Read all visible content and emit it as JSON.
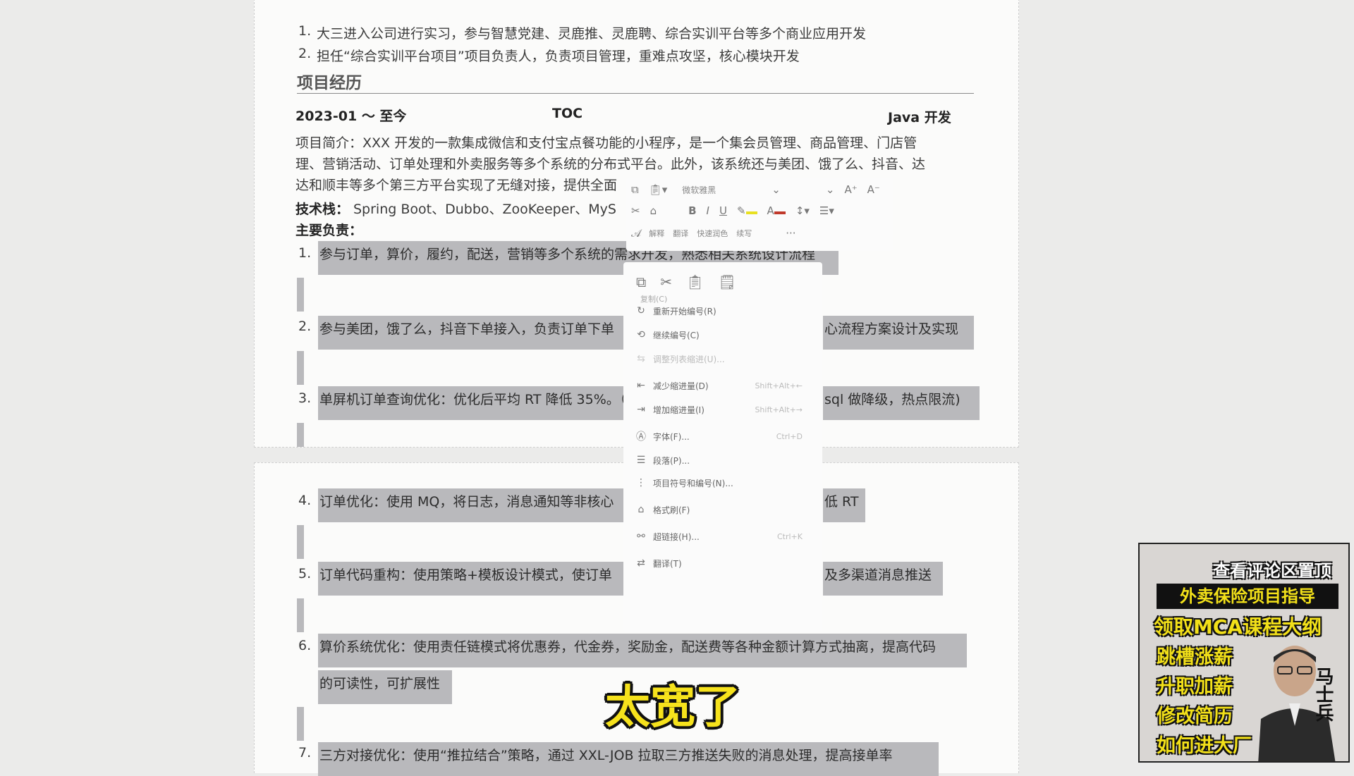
{
  "document": {
    "internship_lines": [
      "大三进入公司进行实习，参与智慧党建、灵鹿推、灵鹿聘、综合实训平台等多个商业应用开发",
      "担任“综合实训平台项目”项目负责人，负责项目管理，重难点攻坚，核心模块开发"
    ],
    "section_title": "项目经历",
    "project": {
      "period": "2023-01 ～ 至今",
      "name": "TOC",
      "role": "Java 开发",
      "intro_lines": [
        "项目简介：XXX 开发的一款集成微信和支付宝点餐功能的小程序，是一个集会员管理、商品管理、门店管",
        "理、营销活动、订单处理和外卖服务等多个系统的分布式平台。此外，该系统还与美团、饿了么、抖音、达",
        "达和顺丰等多个第三方平台实现了无缝对接，提供全面"
      ],
      "tech_label": "技术栈：",
      "tech_value": "Spring Boot、Dubbo、ZooKeeper、MyS",
      "duty_label": "主要负责："
    },
    "duties": [
      {
        "num": "1.",
        "left": "参与订单，算价，履约，配送，营销等多个系统的需求开发，熟悉相关系统设计流程",
        "right": ""
      },
      {
        "num": "2.",
        "left": "参与美团，饿了么，抖音下单接入，负责订单下单",
        "right": "心流程方案设计及实现"
      },
      {
        "num": "3.",
        "left": "单屏机订单查询优化：优化后平均 RT 降低 35%。（",
        "right": "sql 做降级，热点限流)"
      },
      {
        "num": "4.",
        "left": "订单优化：使用 MQ，将日志，消息通知等非核心",
        "right": "低 RT"
      },
      {
        "num": "5.",
        "left": "订单代码重构：使用策略+模板设计模式，使订单",
        "right": "及多渠道消息推送"
      },
      {
        "num": "6.",
        "left": "算价系统优化：使用责任链模式将优惠券，代金券，奖励金，配送费等各种金额计算方式抽离，提高代码",
        "right": "",
        "cont": "的可读性，可扩展性"
      },
      {
        "num": "7.",
        "left": "三方对接优化：使用“推拉结合”策略，通过 XXL-JOB 拉取三方推送失败的消息处理，提高接单率",
        "right": ""
      }
    ]
  },
  "mini_toolbar": {
    "font_name": "微软雅黑",
    "font_size": "",
    "grow_font": "A⁺",
    "shrink_font": "A⁻",
    "bold": "B",
    "italic": "I",
    "underline": "U",
    "actions": [
      "解释",
      "翻译",
      "快速润色",
      "续写"
    ],
    "more": "···"
  },
  "context_menu": {
    "paste_hint": "复制(C)",
    "items": [
      {
        "icon": "restart-numbering-icon",
        "glyph": "↻",
        "label": "重新开始编号(R)",
        "shortcut": "",
        "disabled": false
      },
      {
        "icon": "continue-numbering-icon",
        "glyph": "⟲",
        "label": "继续编号(C)",
        "shortcut": "",
        "disabled": false
      },
      {
        "icon": "adjust-list-indent-icon",
        "glyph": "⇆",
        "label": "调整列表缩进(U)...",
        "shortcut": "",
        "disabled": true
      },
      {
        "icon": "decrease-indent-icon",
        "glyph": "⇤",
        "label": "减少缩进量(D)",
        "shortcut": "Shift+Alt+←",
        "disabled": false
      },
      {
        "icon": "increase-indent-icon",
        "glyph": "⇥",
        "label": "增加缩进量(I)",
        "shortcut": "Shift+Alt+→",
        "disabled": false
      },
      {
        "icon": "font-icon",
        "glyph": "Ⓐ",
        "label": "字体(F)...",
        "shortcut": "Ctrl+D",
        "disabled": false
      },
      {
        "icon": "paragraph-icon",
        "glyph": "☰",
        "label": "段落(P)...",
        "shortcut": "",
        "disabled": false
      },
      {
        "icon": "bullets-numbering-icon",
        "glyph": "⋮",
        "label": "项目符号和编号(N)...",
        "shortcut": "",
        "disabled": false
      },
      {
        "icon": "format-painter-icon",
        "glyph": "⌂",
        "label": "格式刷(F)",
        "shortcut": "",
        "disabled": false
      },
      {
        "icon": "hyperlink-icon",
        "glyph": "⚯",
        "label": "超链接(H)...",
        "shortcut": "Ctrl+K",
        "disabled": false
      },
      {
        "icon": "translate-icon",
        "glyph": "⇄",
        "label": "翻译(T)",
        "shortcut": "",
        "disabled": false
      }
    ]
  },
  "subtitle": "太宽了",
  "promo": {
    "top": "查看评论区置顶",
    "line1": "外卖保险项目指导",
    "line2": "领取MCA课程大纲",
    "items": [
      "跳槽涨薪",
      "升职加薪",
      "修改简历",
      "如何进大厂"
    ],
    "vertical_label": "马士兵"
  }
}
